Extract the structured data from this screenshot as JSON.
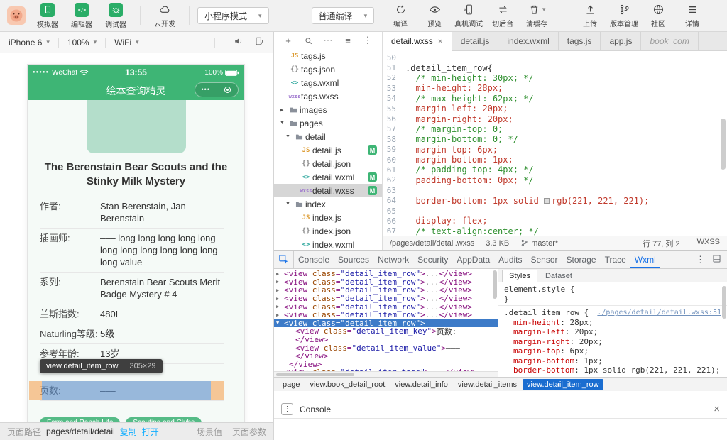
{
  "topbar": {
    "tools": [
      {
        "icon": "simulator-icon",
        "label": "模拟器"
      },
      {
        "icon": "editor-icon",
        "label": "编辑器"
      },
      {
        "icon": "debugger-icon",
        "label": "调试器"
      }
    ],
    "cloud": {
      "icon": "cloud-dev-icon",
      "label": "云开发"
    },
    "mode_select": {
      "value": "小程序模式"
    },
    "compile_select": {
      "value": "普通编译"
    },
    "actions": [
      {
        "icon": "compile-icon",
        "label": "编译"
      },
      {
        "icon": "preview-icon",
        "label": "预览"
      },
      {
        "icon": "real-device-icon",
        "label": "真机调试"
      },
      {
        "icon": "switch-background-icon",
        "label": "切后台"
      },
      {
        "icon": "clear-cache-icon",
        "label": "清缓存",
        "caret": true
      }
    ],
    "right_actions": [
      {
        "icon": "upload-icon",
        "label": "上传"
      },
      {
        "icon": "version-icon",
        "label": "版本管理"
      },
      {
        "icon": "community-icon",
        "label": "社区"
      },
      {
        "icon": "details-icon",
        "label": "详情"
      }
    ]
  },
  "device_bar": {
    "device": "iPhone 6",
    "zoom": "100%",
    "network": "WiFi",
    "icons": [
      "mute-icon",
      "rotate-icon"
    ]
  },
  "simulator": {
    "status": {
      "signal": "●●●●●",
      "carrier": "WeChat",
      "time": "13:55",
      "battery": "100%"
    },
    "nav": {
      "title": "绘本查询精灵",
      "capsule_dots": "•••"
    },
    "book_title": "The Berenstain Bear Scouts and the Stinky Milk Mystery",
    "rows": [
      {
        "key": "作者:",
        "value": "Stan Berenstain, Jan Berenstain"
      },
      {
        "key": "插画师:",
        "value": "––– long long long long long long long long long long long long value"
      },
      {
        "key": "系列:",
        "value": "Berenstain Bear Scouts Merit Badge Mystery # 4"
      },
      {
        "key": "兰斯指数:",
        "value": "480L"
      },
      {
        "key": "Naturling等级:",
        "value": "5级"
      },
      {
        "key": "参考年龄:",
        "value": "13岁"
      },
      {
        "spacer": true
      },
      {
        "key": "页数:",
        "value": "–––",
        "highlight": true
      }
    ],
    "tags": [
      "Farm and Ranch Life",
      "Scouting and Clubs"
    ],
    "tooltip": {
      "name": "view.detail_item_row",
      "size": "305×29"
    }
  },
  "explorer": {
    "toolbar_icons": [
      "new-file-icon",
      "search-icon",
      "more-icon",
      "sort-icon",
      "vertical-dots-icon"
    ],
    "items": [
      {
        "icon": "js",
        "label": "tags.js",
        "level": 1
      },
      {
        "icon": "json",
        "label": "tags.json",
        "level": 1
      },
      {
        "icon": "wxml",
        "label": "tags.wxml",
        "level": 1
      },
      {
        "icon": "wxss",
        "label": "tags.wxss",
        "level": 1
      },
      {
        "type": "folder",
        "arrow": "▶",
        "label": "images",
        "level": 0
      },
      {
        "type": "folder",
        "arrow": "▼",
        "label": "pages",
        "level": 0
      },
      {
        "type": "folder",
        "arrow": "▼",
        "label": "detail",
        "level": 1
      },
      {
        "icon": "js",
        "label": "detail.js",
        "level": 2,
        "badge": "M"
      },
      {
        "icon": "json",
        "label": "detail.json",
        "level": 2
      },
      {
        "icon": "wxml",
        "label": "detail.wxml",
        "level": 2,
        "badge": "M"
      },
      {
        "icon": "wxss",
        "label": "detail.wxss",
        "level": 2,
        "badge": "M",
        "selected": true
      },
      {
        "type": "folder",
        "arrow": "▼",
        "label": "index",
        "level": 1
      },
      {
        "icon": "js",
        "label": "index.js",
        "level": 2
      },
      {
        "icon": "json",
        "label": "index.json",
        "level": 2
      },
      {
        "icon": "wxml",
        "label": "index.wxml",
        "level": 2
      }
    ]
  },
  "editor": {
    "tabs": [
      {
        "label": "detail.wxss",
        "active": true,
        "close": true
      },
      {
        "label": "detail.js"
      },
      {
        "label": "index.wxml"
      },
      {
        "label": "tags.js"
      },
      {
        "label": "app.js"
      },
      {
        "label": "book_com",
        "preview": true
      }
    ],
    "lines": [
      {
        "n": 50,
        "seg": []
      },
      {
        "n": 51,
        "seg": [
          [
            "sel",
            ".detail_item_row{"
          ]
        ]
      },
      {
        "n": 52,
        "seg": [
          [
            "com",
            "  /* min-height: 30px; */"
          ]
        ]
      },
      {
        "n": 53,
        "seg": [
          [
            "prop",
            "  min-height: 28px;"
          ]
        ]
      },
      {
        "n": 54,
        "seg": [
          [
            "com",
            "  /* max-height: 62px; */"
          ]
        ]
      },
      {
        "n": 55,
        "seg": [
          [
            "prop",
            "  margin-left: 20px;"
          ]
        ]
      },
      {
        "n": 56,
        "seg": [
          [
            "prop",
            "  margin-right: 20px;"
          ]
        ]
      },
      {
        "n": 57,
        "seg": [
          [
            "com",
            "  /* margin-top: 0;"
          ]
        ]
      },
      {
        "n": 58,
        "seg": [
          [
            "com",
            "  margin-bottom: 0; */"
          ]
        ]
      },
      {
        "n": 59,
        "seg": [
          [
            "prop",
            "  margin-top: 6px;"
          ]
        ]
      },
      {
        "n": 60,
        "seg": [
          [
            "prop",
            "  margin-bottom: 1px;"
          ]
        ]
      },
      {
        "n": 61,
        "seg": [
          [
            "com",
            "  /* padding-top: 4px; */"
          ]
        ]
      },
      {
        "n": 62,
        "seg": [
          [
            "prop",
            "  padding-bottom: 0px;"
          ],
          [
            "com",
            " */"
          ]
        ]
      },
      {
        "n": 63,
        "seg": []
      },
      {
        "n": 64,
        "seg": [
          [
            "prop",
            "  border-bottom: 1px solid "
          ],
          [
            "swatch",
            "#dddddd"
          ],
          [
            "prop",
            "rgb(221, 221, 221);"
          ]
        ]
      },
      {
        "n": 65,
        "seg": []
      },
      {
        "n": 66,
        "seg": [
          [
            "prop",
            "  display: flex;"
          ]
        ]
      },
      {
        "n": 67,
        "seg": [
          [
            "com",
            "  /* text-align:center; */"
          ]
        ]
      }
    ],
    "status": {
      "path": "/pages/detail/detail.wxss",
      "size": "3.3 KB",
      "branch": "master*",
      "cursor": "行 77, 列 2",
      "lang": "WXSS"
    }
  },
  "devtools": {
    "tabs": [
      "Console",
      "Sources",
      "Network",
      "Security",
      "AppData",
      "Audits",
      "Sensor",
      "Storage",
      "Trace",
      "Wxml"
    ],
    "active_tab": "Wxml",
    "right_icons": [
      "vertical-dots-icon",
      "dock-icon"
    ],
    "collapsed_ellipsis": "...",
    "wxml_nodes": [
      {
        "t": "collapsed",
        "cls": "detail_item_row"
      },
      {
        "t": "collapsed",
        "cls": "detail_item_row"
      },
      {
        "t": "collapsed",
        "cls": "detail_item_row"
      },
      {
        "t": "collapsed",
        "cls": "detail_item_row"
      },
      {
        "t": "collapsed",
        "cls": "detail_item_row"
      },
      {
        "t": "collapsed",
        "cls": "detail_item_row"
      },
      {
        "t": "open",
        "cls": "detail_item_row",
        "selected": true
      },
      {
        "t": "child",
        "cls": "detail_item_key",
        "text": "页数:"
      },
      {
        "t": "close",
        "level": 2
      },
      {
        "t": "child",
        "cls": "detail_item_value",
        "text": "–––"
      },
      {
        "t": "close",
        "level": 2
      },
      {
        "t": "close",
        "level": 1
      },
      {
        "t": "collapsed",
        "cls": "detail_item_tags"
      }
    ],
    "styles_pane": {
      "tabs": [
        "Styles",
        "Dataset"
      ],
      "active_tab": "Styles",
      "element_style_selector": "element.style",
      "rule_selector": ".detail_item_row",
      "rule_source": "./pages/detail/detail.wxss:51",
      "props": [
        {
          "name": "min-height",
          "value": "28px"
        },
        {
          "name": "margin-left",
          "value": "20px"
        },
        {
          "name": "margin-right",
          "value": "20px"
        },
        {
          "name": "margin-top",
          "value": "6px"
        },
        {
          "name": "margin-bottom",
          "value": "1px"
        },
        {
          "name": "border-bottom",
          "value": "1px solid rgb(221, 221, 221)"
        }
      ]
    },
    "breadcrumb": [
      {
        "label": "page"
      },
      {
        "label": "view.book_detail_root"
      },
      {
        "label": "view.detail_info"
      },
      {
        "label": "view.detail_items"
      },
      {
        "label": "view.detail_item_row",
        "active": true
      }
    ]
  },
  "console_drawer": {
    "label": "Console"
  },
  "footer": {
    "path_label": "页面路径",
    "path": "pages/detail/detail",
    "copy": "复制",
    "open": "打开",
    "scene": "场景值",
    "params": "页面参数"
  }
}
